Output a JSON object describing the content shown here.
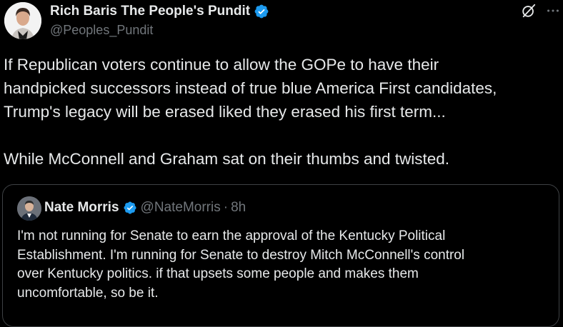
{
  "post": {
    "author_name": "Rich Baris The People's Pundit",
    "author_handle": "@Peoples_Pundit",
    "text_lines": [
      "If Republican voters continue to allow the GOPe to have their",
      "handpicked successors instead of true blue America First candidates,",
      "Trump's legacy will be erased liked they erased his first term...",
      "",
      "While McConnell and Graham sat on their thumbs and twisted."
    ],
    "icons": {
      "verified": "verified-badge-icon",
      "grok": "grok-icon",
      "more": "more-options-icon"
    }
  },
  "quote": {
    "author_name": "Nate Morris",
    "author_handle": "@NateMorris",
    "separator": "·",
    "time": "8h",
    "text_lines": [
      "I'm not running for Senate to earn the approval of the Kentucky Political",
      "Establishment. I'm running for Senate to destroy Mitch McConnell's control",
      "over Kentucky politics. if that upsets some people and makes them",
      "uncomfortable, so be it."
    ]
  },
  "colors": {
    "background": "#000000",
    "text_primary": "#e7e9ea",
    "text_secondary": "#71767b",
    "verified_blue": "#1d9bf0",
    "card_border": "#3e4144"
  }
}
